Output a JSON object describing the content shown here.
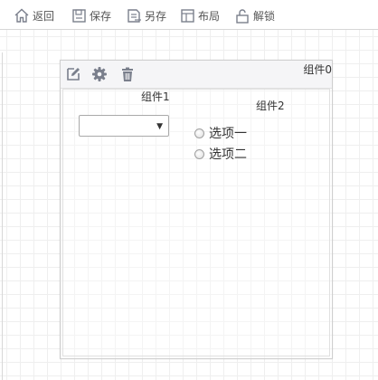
{
  "toolbar": {
    "back_label": "返回",
    "save_label": "保存",
    "saveas_label": "另存",
    "layout_label": "布局",
    "unlock_label": "解锁",
    "icons": [
      "home-icon",
      "save-icon",
      "save-as-icon",
      "layout-icon",
      "unlock-icon"
    ]
  },
  "panel": {
    "title": "组件0",
    "actions": [
      "edit-icon",
      "gear-icon",
      "trash-icon"
    ]
  },
  "component1": {
    "label": "组件1",
    "select_value": ""
  },
  "component2": {
    "label": "组件2",
    "options": [
      "选项一",
      "选项二"
    ]
  },
  "colors": {
    "icon": "#7a7f8c",
    "grid_line": "#efefef",
    "border": "#cfcfcf"
  }
}
